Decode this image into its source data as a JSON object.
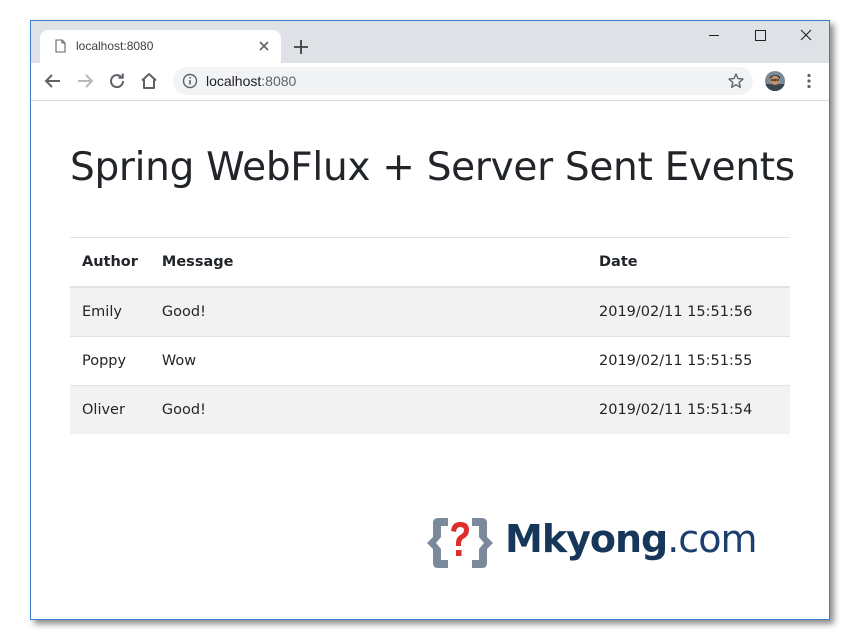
{
  "browser": {
    "tab_title": "localhost:8080",
    "url_host": "localhost",
    "url_port": ":8080",
    "icons": {
      "favicon": "page-icon",
      "close": "close-icon",
      "new_tab": "plus-icon",
      "back": "arrow-left-icon",
      "forward": "arrow-right-icon",
      "reload": "reload-icon",
      "home": "home-icon",
      "site_info": "info-icon",
      "bookmark": "star-icon",
      "menu": "vertical-dots-icon"
    },
    "colors": {
      "titlebar": "#dee1e6",
      "omnibox": "#f1f3f4",
      "window_border": "#3c7fc9"
    }
  },
  "page": {
    "title": "Spring WebFlux + Server Sent Events",
    "table": {
      "headers": [
        "Author",
        "Message",
        "Date"
      ],
      "rows": [
        {
          "author": "Emily",
          "message": "Good!",
          "date": "2019/02/11 15:51:56"
        },
        {
          "author": "Poppy",
          "message": "Wow",
          "date": "2019/02/11 15:51:55"
        },
        {
          "author": "Oliver",
          "message": "Good!",
          "date": "2019/02/11 15:51:54"
        }
      ]
    },
    "logo": {
      "brand": "Mkyong",
      "tld": ".com",
      "colors": {
        "brand": "#16365a",
        "mark_bracket": "#7b8a9b",
        "mark_question": "#e12c2c"
      }
    }
  }
}
